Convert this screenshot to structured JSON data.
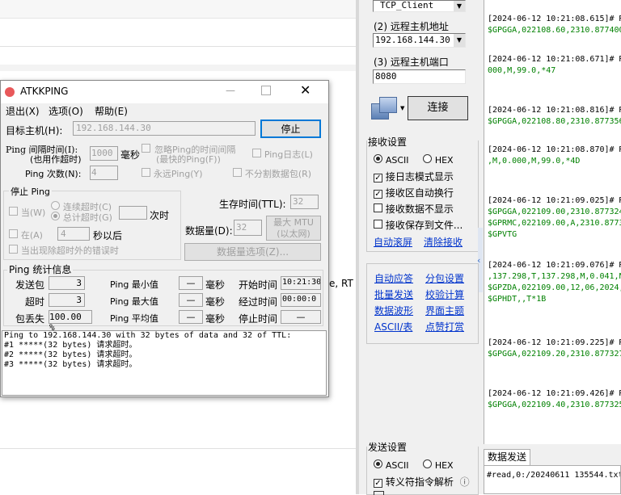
{
  "background_app": {
    "remote_host_label": "(2) 远程主机地址",
    "remote_host_value": "192.168.144.30",
    "remote_port_label": "(3) 远程主机端口",
    "remote_port_value": "8080",
    "protocol_value": "TCP_Client",
    "connect_button": "连接",
    "receive_settings": {
      "title": "接收设置",
      "ascii": "ASCII",
      "hex": "HEX",
      "checkboxes": [
        "接日志模式显示",
        "接收区自动换行",
        "接收数据不显示",
        "接收保存到文件..."
      ],
      "checked": [
        true,
        true,
        false,
        false
      ],
      "auto_scroll": "自动滚屏",
      "clear_receive": "清除接收"
    },
    "tools": {
      "row1": [
        "自动应答",
        "分包设置"
      ],
      "row2": [
        "批量发送",
        "校验计算"
      ],
      "row3": [
        "数据波形",
        "界面主题"
      ],
      "row4": [
        "ASCII/表",
        "点赞打赏"
      ]
    },
    "send_settings": {
      "title": "发送设置",
      "ascii": "ASCII",
      "hex": "HEX",
      "escape_label": "转义符指令解析",
      "info_icon": "ⓘ"
    },
    "send_tab": "数据发送",
    "send_text": "#read,0:/20240611 135544.txt",
    "log_lines": [
      {
        "ts": "[2024-06-12 10:21:08.615]# R",
        "data": "$GPGGA,022108.60,2310.877400"
      },
      {
        "ts": "[2024-06-12 10:21:08.671]# R",
        "data": "000,M,99.0,*47"
      },
      {
        "ts": "[2024-06-12 10:21:08.816]# R",
        "data": "$GPGGA,022108.80,2310.877356"
      },
      {
        "ts": "[2024-06-12 10:21:08.870]# R",
        "data": ",M,0.000,M,99.0,*4D"
      },
      {
        "ts": "[2024-06-12 10:21:09.025]# R",
        "data": "$GPGGA,022109.00,2310.877324",
        "extra": [
          "$GPRMC,022109.00,A,2310.8773",
          "$GPVTG"
        ]
      },
      {
        "ts": "[2024-06-12 10:21:09.076]# R",
        "data": ",137.298,T,137.298,M,0.041,N",
        "extra": [
          "$GPZDA,022109.00,12,06,2024,",
          "$GPHDT,,T*1B"
        ]
      },
      {
        "ts": "[2024-06-12 10:21:09.225]# R",
        "data": "$GPGGA,022109.20,2310.877327"
      },
      {
        "ts": "[2024-06-12 10:21:09.426]# R",
        "data": "$GPGGA,022109.40,2310.877325"
      }
    ],
    "left_text_fragment": "e, RT"
  },
  "dialog": {
    "title": "ATKKPING",
    "menu": [
      "退出(X)",
      "选项(O)",
      "帮助(E)"
    ],
    "target_label": "目标主机(H):",
    "target_value": "192.168.144.30",
    "stop_button": "停止",
    "ping_interval_label1": "Ping 间隔时间(I):",
    "ping_interval_label2": "(也用作超时)",
    "ping_interval_value": "1000",
    "ms": "毫秒",
    "ignore_time_label1": "忽略Ping的时间间隔",
    "ignore_time_label2": "(最快的Ping(F))",
    "ping_log": "Ping日志(L)",
    "ping_count_label": "Ping 次数(N):",
    "ping_count_value": "4",
    "forever_ping": "永远Ping(Y)",
    "no_fragment": "不分割数据包(R)",
    "stop_group_title": "停止 Ping",
    "when": "当(W)",
    "continuous_timeout": "连续超时(C)",
    "total_timeout": "总计超时(G)",
    "times": "次时",
    "at": "在(A)",
    "at_value": "4",
    "seconds_after": "秒以后",
    "on_error": "当出现除超时外的错误时",
    "ttl_label": "生存时间(TTL):",
    "ttl_value": "32",
    "data_size_label": "数据量(D):",
    "data_size_value": "32",
    "max_mtu1": "最大 MTU",
    "max_mtu2": "(以太网)",
    "data_options": "数据量选项(Z)...",
    "stats_title": "Ping 统计信息",
    "sent_label": "发送包",
    "sent_value": "3",
    "timeout_label": "超时",
    "timeout_value": "3",
    "loss_label": "包丢失",
    "loss_value": "100.00 %",
    "min_label": "Ping 最小值",
    "max_label": "Ping 最大值",
    "avg_label": "Ping 平均值",
    "dash": "—",
    "start_time_label": "开始时间",
    "start_time_value": "10:21:30",
    "elapsed_label": "经过时间",
    "elapsed_value": "00:00:0",
    "stop_time_label": "停止时间",
    "stop_time_value": "—",
    "output_lines": [
      "Ping to 192.168.144.30 with 32 bytes of data and 32 of TTL:",
      "#1 *****(32 bytes) 请求超时。",
      "#2 *****(32 bytes) 请求超时。",
      "#3 *****(32 bytes) 请求超时。"
    ]
  }
}
